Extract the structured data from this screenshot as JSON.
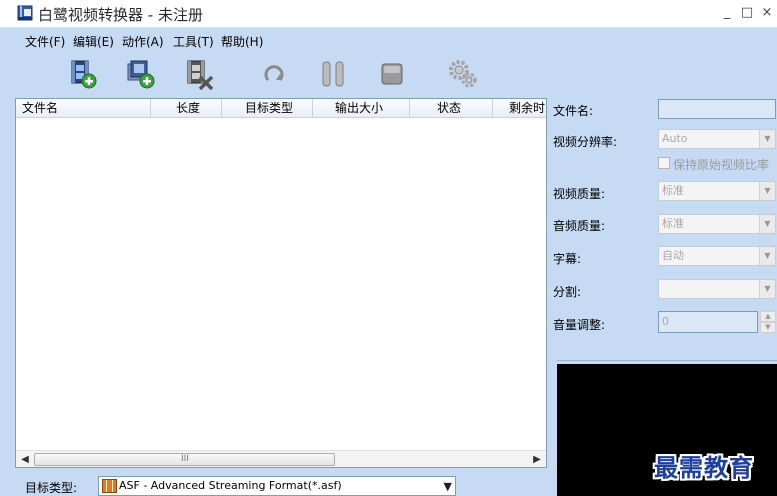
{
  "window": {
    "title": "白鹭视频转换器 - 未注册",
    "icon": "film-app-icon",
    "controls": [
      "_",
      "□",
      "×"
    ]
  },
  "menu": [
    {
      "label": "文件(F)"
    },
    {
      "label": "编辑(E)"
    },
    {
      "label": "动作(A)"
    },
    {
      "label": "工具(T)"
    },
    {
      "label": "帮助(H)"
    }
  ],
  "toolbar": [
    {
      "icon": "add-file-icon"
    },
    {
      "icon": "add-folder-icon"
    },
    {
      "icon": "remove-file-icon"
    },
    {
      "icon": "convert-icon"
    },
    {
      "icon": "pause-icon"
    },
    {
      "icon": "stop-icon"
    },
    {
      "icon": "settings-gears-icon"
    }
  ],
  "file_list": {
    "columns": [
      "文件名",
      "长度",
      "目标类型",
      "输出大小",
      "状态",
      "剩余时"
    ],
    "rows": [],
    "scrollbar_grip": "III"
  },
  "target_type": {
    "label": "目标类型:",
    "value": "ASF - Advanced Streaming Format(*.asf)"
  },
  "settings": {
    "filename_label": "文件名:",
    "filename_value": "",
    "resolution_label": "视频分辨率:",
    "resolution_value": "Auto",
    "keep_ratio_label": "保持原始视频比率",
    "keep_ratio_checked": false,
    "video_quality_label": "视频质量:",
    "video_quality_value": "标准",
    "audio_quality_label": "音频质量:",
    "audio_quality_value": "标准",
    "subtitle_label": "字幕:",
    "subtitle_value": "自动",
    "split_label": "分割:",
    "split_value": "",
    "volume_label": "音量调整:",
    "volume_value": "0"
  },
  "watermark": "最需教育",
  "colors": {
    "background": "#c6daf4",
    "preview": "#000000",
    "watermark": "#1f3f9c",
    "format_icon": "#e07b22"
  }
}
